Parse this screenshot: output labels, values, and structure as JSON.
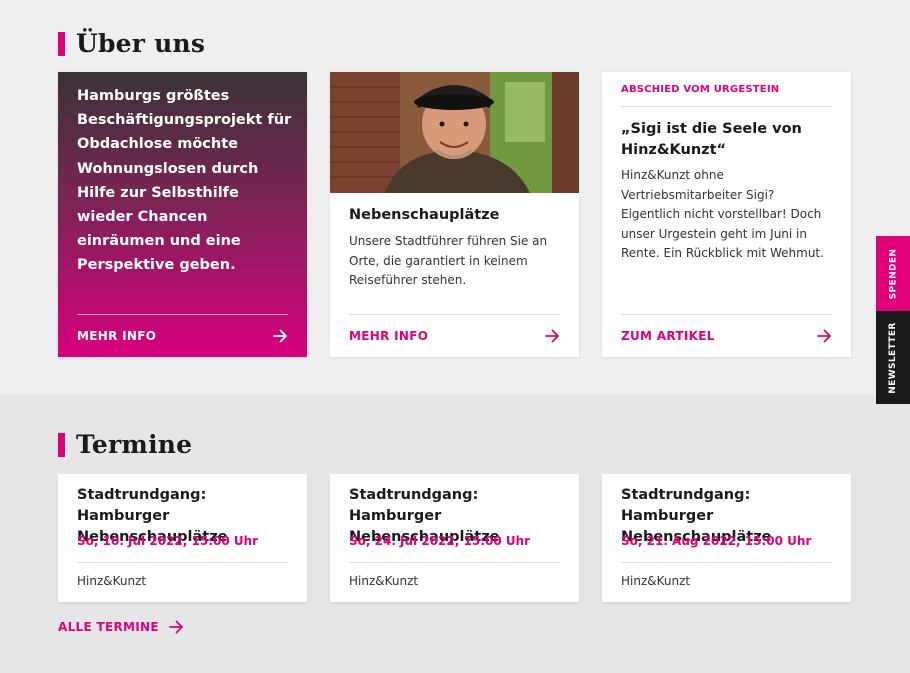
{
  "about": {
    "heading": "Über uns",
    "promo": {
      "text": "Hamburgs größtes Beschäftigungsprojekt für Obdachlose möchte Wohnungslosen durch Hilfe zur Selbsthilfe wieder Chancen einräumen und eine Perspektive geben.",
      "cta": "MEHR INFO"
    },
    "tour": {
      "title": "Nebenschauplätze",
      "body": "Unsere Stadtführer führen Sie an Orte, die garantiert in keinem Reiseführer stehen.",
      "cta": "MEHR INFO"
    },
    "article": {
      "kicker": "ABSCHIED VOM URGESTEIN",
      "title": "„Sigi ist die Seele von Hinz&Kunzt“",
      "body": "Hinz&Kunzt ohne Vertriebsmitarbeiter Sigi? Eigentlich nicht vorstellbar! Doch unser Urgestein geht im Juni in Rente. Ein Rückblick mit Wehmut.",
      "cta": "ZUM ARTIKEL"
    }
  },
  "side_tabs": {
    "spenden": "SPENDEN",
    "newsletter": "NEWSLETTER"
  },
  "events": {
    "heading": "Termine",
    "items": [
      {
        "title": "Stadtrundgang: Hamburger Nebenschauplätze",
        "date": "So, 10. Jul 2022, 15:00 Uhr",
        "organizer": "Hinz&Kunzt"
      },
      {
        "title": "Stadtrundgang: Hamburger Nebenschauplätze",
        "date": "So, 24. Jul 2022, 15:00 Uhr",
        "organizer": "Hinz&Kunzt"
      },
      {
        "title": "Stadtrundgang: Hamburger Nebenschauplätze",
        "date": "So, 21. Aug 2022, 15:00 Uhr",
        "organizer": "Hinz&Kunzt"
      }
    ],
    "all_link": "ALLE TERMINE"
  },
  "colors": {
    "accent": "#e2007a",
    "dark": "#1a1a1a"
  },
  "icons": {
    "cta_arrow": "arrow-right-icon"
  }
}
